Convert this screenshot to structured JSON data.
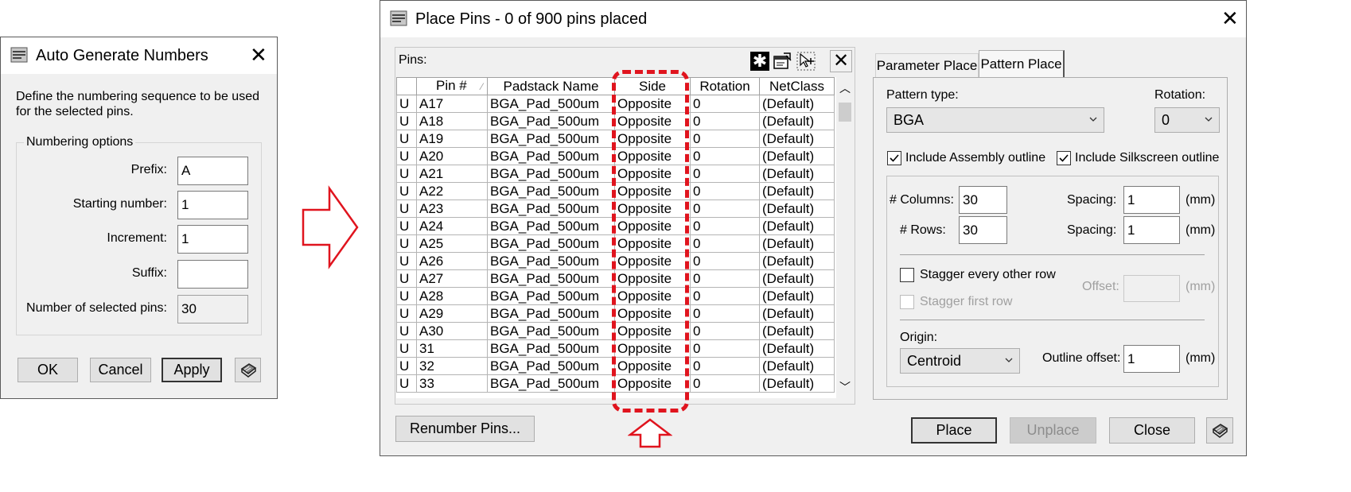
{
  "auto_dialog": {
    "title": "Auto Generate Numbers",
    "description_line1": "Define the numbering sequence to be used",
    "description_line2": "for the selected pins.",
    "group_title": "Numbering options",
    "prefix_label": "Prefix:",
    "prefix_value": "A",
    "start_label": "Starting number:",
    "start_value": "1",
    "increment_label": "Increment:",
    "increment_value": "1",
    "suffix_label": "Suffix:",
    "suffix_value": "",
    "count_label": "Number of selected pins:",
    "count_value": "30",
    "ok_label": "OK",
    "cancel_label": "Cancel",
    "apply_label": "Apply"
  },
  "place_dialog": {
    "title": "Place Pins - 0 of 900 pins placed",
    "pins_label": "Pins:",
    "columns": [
      "Pin #",
      "Padstack Name",
      "Side",
      "Rotation",
      "NetClass"
    ],
    "rows": [
      [
        "U",
        "A17",
        "BGA_Pad_500um",
        "Opposite",
        "0",
        "(Default)"
      ],
      [
        "U",
        "A18",
        "BGA_Pad_500um",
        "Opposite",
        "0",
        "(Default)"
      ],
      [
        "U",
        "A19",
        "BGA_Pad_500um",
        "Opposite",
        "0",
        "(Default)"
      ],
      [
        "U",
        "A20",
        "BGA_Pad_500um",
        "Opposite",
        "0",
        "(Default)"
      ],
      [
        "U",
        "A21",
        "BGA_Pad_500um",
        "Opposite",
        "0",
        "(Default)"
      ],
      [
        "U",
        "A22",
        "BGA_Pad_500um",
        "Opposite",
        "0",
        "(Default)"
      ],
      [
        "U",
        "A23",
        "BGA_Pad_500um",
        "Opposite",
        "0",
        "(Default)"
      ],
      [
        "U",
        "A24",
        "BGA_Pad_500um",
        "Opposite",
        "0",
        "(Default)"
      ],
      [
        "U",
        "A25",
        "BGA_Pad_500um",
        "Opposite",
        "0",
        "(Default)"
      ],
      [
        "U",
        "A26",
        "BGA_Pad_500um",
        "Opposite",
        "0",
        "(Default)"
      ],
      [
        "U",
        "A27",
        "BGA_Pad_500um",
        "Opposite",
        "0",
        "(Default)"
      ],
      [
        "U",
        "A28",
        "BGA_Pad_500um",
        "Opposite",
        "0",
        "(Default)"
      ],
      [
        "U",
        "A29",
        "BGA_Pad_500um",
        "Opposite",
        "0",
        "(Default)"
      ],
      [
        "U",
        "A30",
        "BGA_Pad_500um",
        "Opposite",
        "0",
        "(Default)"
      ],
      [
        "U",
        "31",
        "BGA_Pad_500um",
        "Opposite",
        "0",
        "(Default)"
      ],
      [
        "U",
        "32",
        "BGA_Pad_500um",
        "Opposite",
        "0",
        "(Default)"
      ],
      [
        "U",
        "33",
        "BGA_Pad_500um",
        "Opposite",
        "0",
        "(Default)"
      ]
    ],
    "renumber_label": "Renumber Pins...",
    "tabs": [
      "Parameter Place",
      "Pattern Place"
    ],
    "pattern_type_label": "Pattern type:",
    "pattern_type_value": "BGA",
    "rotation_label": "Rotation:",
    "rotation_value": "0",
    "assembly_label": "Include Assembly outline",
    "silkscreen_label": "Include Silkscreen outline",
    "columns_label": "# Columns:",
    "columns_value": "30",
    "rows_label": "# Rows:",
    "rows_value": "30",
    "spacing_label": "Spacing:",
    "col_spacing_value": "1",
    "row_spacing_value": "1",
    "unit_mm": "(mm)",
    "stagger_every_label": "Stagger every other row",
    "stagger_first_label": "Stagger first row",
    "offset_label": "Offset:",
    "offset_value": "",
    "origin_label": "Origin:",
    "origin_value": "Centroid",
    "outline_offset_label": "Outline offset:",
    "outline_offset_value": "1",
    "place_label": "Place",
    "unplace_label": "Unplace",
    "close_label": "Close"
  },
  "colors": {
    "highlight": "#e0141e",
    "dialog_bg": "#f0f0f0"
  }
}
